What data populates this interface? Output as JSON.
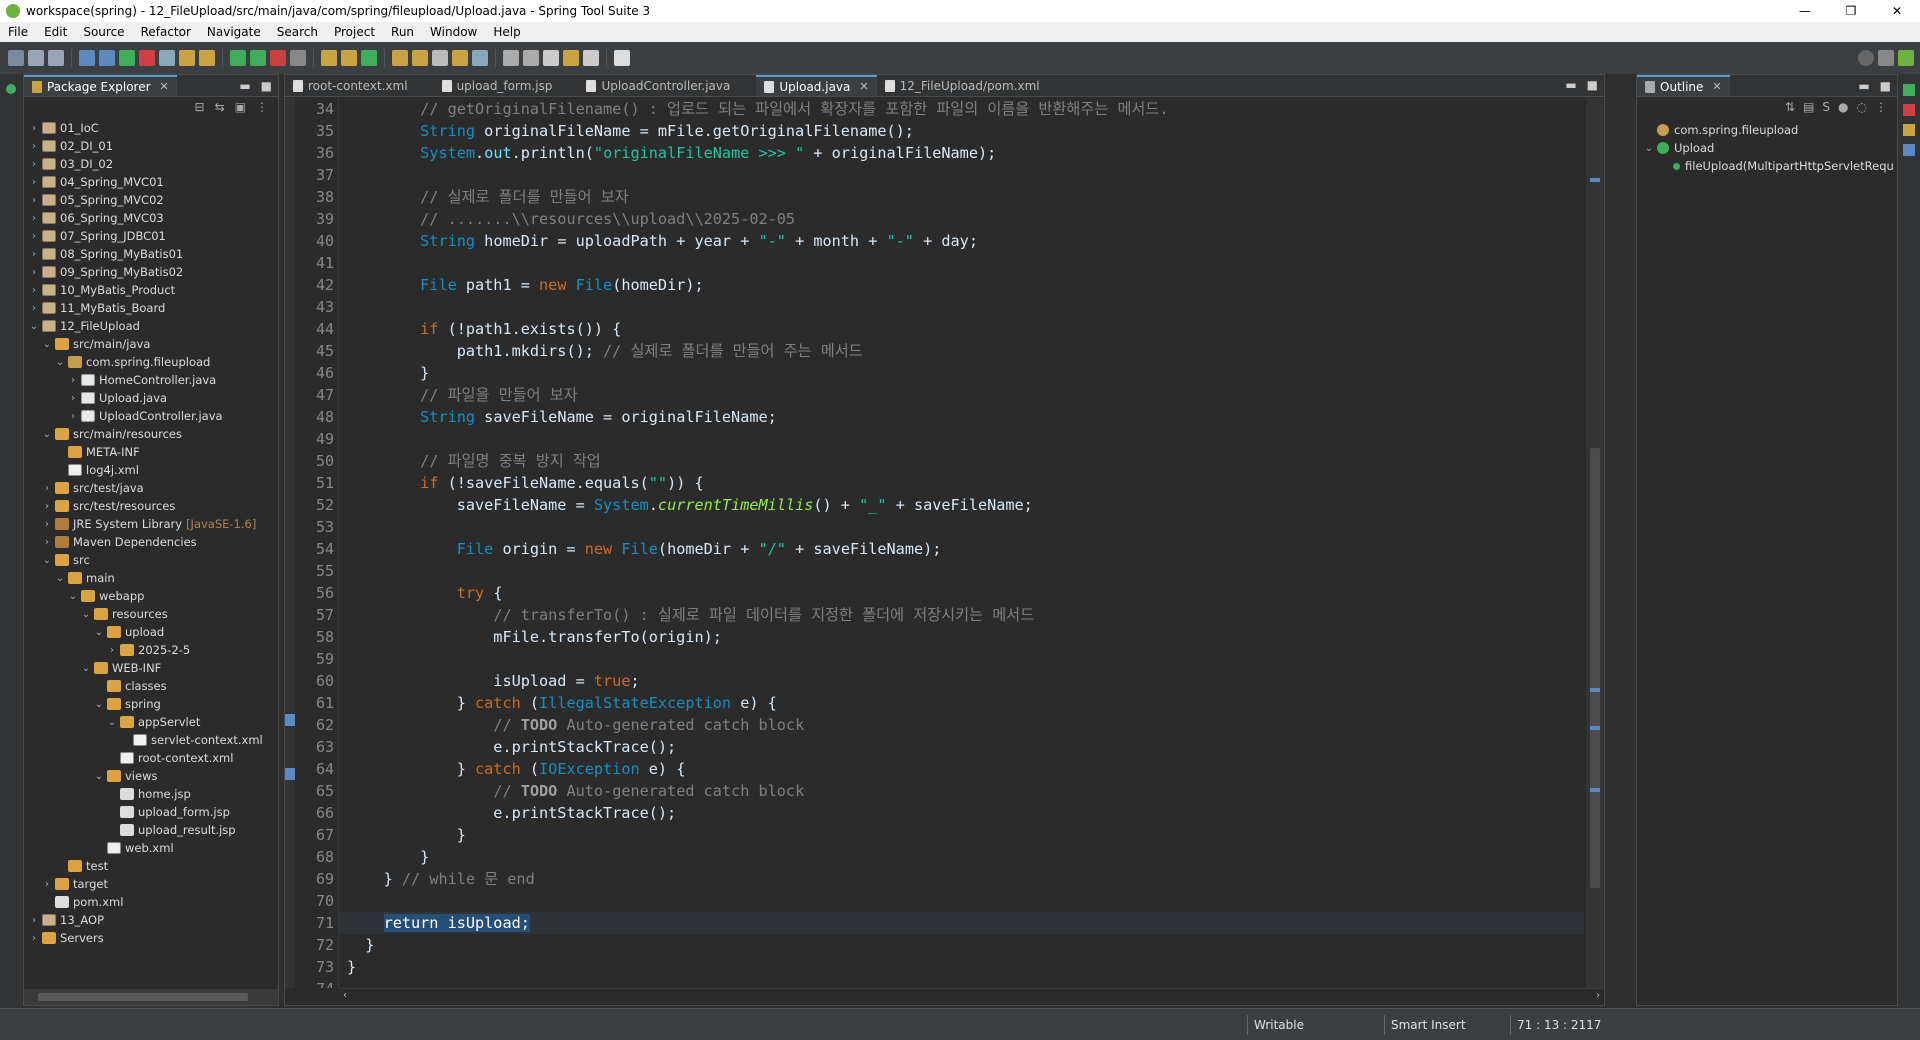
{
  "window": {
    "title": "workspace(spring) - 12_FileUpload/src/main/java/com/spring/fileupload/Upload.java - Spring Tool Suite 3",
    "controls": [
      "—",
      "❐",
      "✕"
    ]
  },
  "menu": [
    "File",
    "Edit",
    "Source",
    "Refactor",
    "Navigate",
    "Search",
    "Project",
    "Run",
    "Window",
    "Help"
  ],
  "package_explorer": {
    "title": "Package Explorer",
    "items": [
      {
        "label": "01_IoC",
        "indent": 0,
        "tw": "›",
        "icon": "proj"
      },
      {
        "label": "02_DI_01",
        "indent": 0,
        "tw": "›",
        "icon": "proj"
      },
      {
        "label": "03_DI_02",
        "indent": 0,
        "tw": "›",
        "icon": "proj"
      },
      {
        "label": "04_Spring_MVC01",
        "indent": 0,
        "tw": "›",
        "icon": "proj"
      },
      {
        "label": "05_Spring_MVC02",
        "indent": 0,
        "tw": "›",
        "icon": "proj"
      },
      {
        "label": "06_Spring_MVC03",
        "indent": 0,
        "tw": "›",
        "icon": "proj"
      },
      {
        "label": "07_Spring_JDBC01",
        "indent": 0,
        "tw": "›",
        "icon": "proj"
      },
      {
        "label": "08_Spring_MyBatis01",
        "indent": 0,
        "tw": "›",
        "icon": "proj"
      },
      {
        "label": "09_Spring_MyBatis02",
        "indent": 0,
        "tw": "›",
        "icon": "proj"
      },
      {
        "label": "10_MyBatis_Product",
        "indent": 0,
        "tw": "›",
        "icon": "proj"
      },
      {
        "label": "11_MyBatis_Board",
        "indent": 0,
        "tw": "›",
        "icon": "proj"
      },
      {
        "label": "12_FileUpload",
        "indent": 0,
        "tw": "⌄",
        "icon": "proj"
      },
      {
        "label": "src/main/java",
        "indent": 1,
        "tw": "⌄",
        "icon": "folder"
      },
      {
        "label": "com.spring.fileupload",
        "indent": 2,
        "tw": "⌄",
        "icon": "pkg"
      },
      {
        "label": "HomeController.java",
        "indent": 3,
        "tw": "›",
        "icon": "java"
      },
      {
        "label": "Upload.java",
        "indent": 3,
        "tw": "›",
        "icon": "java"
      },
      {
        "label": "UploadController.java",
        "indent": 3,
        "tw": "›",
        "icon": "java"
      },
      {
        "label": "src/main/resources",
        "indent": 1,
        "tw": "⌄",
        "icon": "folder"
      },
      {
        "label": "META-INF",
        "indent": 2,
        "tw": "",
        "icon": "folder"
      },
      {
        "label": "log4j.xml",
        "indent": 2,
        "tw": "",
        "icon": "xml"
      },
      {
        "label": "src/test/java",
        "indent": 1,
        "tw": "›",
        "icon": "folder"
      },
      {
        "label": "src/test/resources",
        "indent": 1,
        "tw": "›",
        "icon": "folder"
      },
      {
        "label": "JRE System Library",
        "suffix": "[JavaSE-1.6]",
        "indent": 1,
        "tw": "›",
        "icon": "jar"
      },
      {
        "label": "Maven Dependencies",
        "indent": 1,
        "tw": "›",
        "icon": "jar"
      },
      {
        "label": "src",
        "indent": 1,
        "tw": "⌄",
        "icon": "folder"
      },
      {
        "label": "main",
        "indent": 2,
        "tw": "⌄",
        "icon": "folder"
      },
      {
        "label": "webapp",
        "indent": 3,
        "tw": "⌄",
        "icon": "folder"
      },
      {
        "label": "resources",
        "indent": 4,
        "tw": "⌄",
        "icon": "folder"
      },
      {
        "label": "upload",
        "indent": 5,
        "tw": "⌄",
        "icon": "folder"
      },
      {
        "label": "2025-2-5",
        "indent": 6,
        "tw": "›",
        "icon": "folder"
      },
      {
        "label": "WEB-INF",
        "indent": 4,
        "tw": "⌄",
        "icon": "folder"
      },
      {
        "label": "classes",
        "indent": 5,
        "tw": "",
        "icon": "folder"
      },
      {
        "label": "spring",
        "indent": 5,
        "tw": "⌄",
        "icon": "folder"
      },
      {
        "label": "appServlet",
        "indent": 6,
        "tw": "⌄",
        "icon": "folder"
      },
      {
        "label": "servlet-context.xml",
        "indent": 7,
        "tw": "",
        "icon": "xml"
      },
      {
        "label": "root-context.xml",
        "indent": 6,
        "tw": "",
        "icon": "xml"
      },
      {
        "label": "views",
        "indent": 5,
        "tw": "⌄",
        "icon": "folder"
      },
      {
        "label": "home.jsp",
        "indent": 6,
        "tw": "",
        "icon": "file"
      },
      {
        "label": "upload_form.jsp",
        "indent": 6,
        "tw": "",
        "icon": "file"
      },
      {
        "label": "upload_result.jsp",
        "indent": 6,
        "tw": "",
        "icon": "file"
      },
      {
        "label": "web.xml",
        "indent": 5,
        "tw": "",
        "icon": "xml"
      },
      {
        "label": "test",
        "indent": 2,
        "tw": "",
        "icon": "folder"
      },
      {
        "label": "target",
        "indent": 1,
        "tw": "›",
        "icon": "folder"
      },
      {
        "label": "pom.xml",
        "indent": 1,
        "tw": "",
        "icon": "file"
      },
      {
        "label": "13_AOP",
        "indent": 0,
        "tw": "›",
        "icon": "proj"
      },
      {
        "label": "Servers",
        "indent": 0,
        "tw": "›",
        "icon": "folder"
      }
    ]
  },
  "editor": {
    "tabs": [
      {
        "label": "root-context.xml",
        "active": false
      },
      {
        "label": "upload_form.jsp",
        "active": false
      },
      {
        "label": "UploadController.java",
        "active": false
      },
      {
        "label": "Upload.java",
        "active": true
      },
      {
        "label": "12_FileUpload/pom.xml",
        "active": false
      }
    ],
    "lines": [
      {
        "n": "34",
        "segs": [
          [
            "        ",
            ""
          ],
          [
            "// getOriginalFilename() : 업로드 되는 파일에서 확장자를 포함한 파일의 이름을 반환해주는 메서드.",
            "cm"
          ]
        ]
      },
      {
        "n": "35",
        "segs": [
          [
            "        ",
            ""
          ],
          [
            "String",
            "ty"
          ],
          [
            " originalFileName = mFile.getOriginalFilename();",
            ""
          ]
        ]
      },
      {
        "n": "36",
        "segs": [
          [
            "        ",
            ""
          ],
          [
            "System",
            "ty"
          ],
          [
            ".",
            ""
          ],
          [
            "out",
            "fld"
          ],
          [
            ".println(",
            ""
          ],
          [
            "\"originalFileName >>> \"",
            "str"
          ],
          [
            " + originalFileName);",
            ""
          ]
        ]
      },
      {
        "n": "37",
        "segs": [
          [
            "",
            ""
          ]
        ]
      },
      {
        "n": "38",
        "segs": [
          [
            "        ",
            ""
          ],
          [
            "// 실제로 폴더를 만들어 보자",
            "cm"
          ]
        ]
      },
      {
        "n": "39",
        "segs": [
          [
            "        ",
            ""
          ],
          [
            "// .......\\\\resources\\\\upload\\\\2025-02-05",
            "cm"
          ]
        ]
      },
      {
        "n": "40",
        "segs": [
          [
            "        ",
            ""
          ],
          [
            "String",
            "ty"
          ],
          [
            " homeDir = uploadPath + year + ",
            ""
          ],
          [
            "\"-\"",
            "str"
          ],
          [
            " + month + ",
            ""
          ],
          [
            "\"-\"",
            "str"
          ],
          [
            " + day;",
            ""
          ]
        ]
      },
      {
        "n": "41",
        "segs": [
          [
            "",
            ""
          ]
        ]
      },
      {
        "n": "42",
        "segs": [
          [
            "        ",
            ""
          ],
          [
            "File",
            "ty"
          ],
          [
            " path1 = ",
            ""
          ],
          [
            "new",
            "kw"
          ],
          [
            " ",
            ""
          ],
          [
            "File",
            "ty"
          ],
          [
            "(homeDir);",
            ""
          ]
        ]
      },
      {
        "n": "43",
        "segs": [
          [
            "",
            ""
          ]
        ]
      },
      {
        "n": "44",
        "segs": [
          [
            "        ",
            ""
          ],
          [
            "if",
            "kw"
          ],
          [
            " (!path1.exists()) {",
            ""
          ]
        ]
      },
      {
        "n": "45",
        "segs": [
          [
            "            path1.mkdirs(); ",
            ""
          ],
          [
            "// 실제로 폴더를 만들어 주는 메서드",
            "cm"
          ]
        ]
      },
      {
        "n": "46",
        "segs": [
          [
            "        }",
            ""
          ]
        ]
      },
      {
        "n": "47",
        "segs": [
          [
            "        ",
            ""
          ],
          [
            "// 파일을 만들어 보자",
            "cm"
          ]
        ]
      },
      {
        "n": "48",
        "segs": [
          [
            "        ",
            ""
          ],
          [
            "String",
            "ty"
          ],
          [
            " saveFileName = originalFileName;",
            ""
          ]
        ]
      },
      {
        "n": "49",
        "segs": [
          [
            "",
            ""
          ]
        ]
      },
      {
        "n": "50",
        "segs": [
          [
            "        ",
            ""
          ],
          [
            "// 파일명 중복 방지 작업",
            "cm"
          ]
        ]
      },
      {
        "n": "51",
        "segs": [
          [
            "        ",
            ""
          ],
          [
            "if",
            "kw"
          ],
          [
            " (!saveFileName.equals(",
            ""
          ],
          [
            "\"\"",
            "str"
          ],
          [
            ")) {",
            ""
          ]
        ]
      },
      {
        "n": "52",
        "segs": [
          [
            "            saveFileName = ",
            ""
          ],
          [
            "System",
            "ty"
          ],
          [
            ".",
            ""
          ],
          [
            "currentTimeMillis",
            "it"
          ],
          [
            "() + ",
            ""
          ],
          [
            "\"_\"",
            "str"
          ],
          [
            " + saveFileName;",
            ""
          ]
        ]
      },
      {
        "n": "53",
        "segs": [
          [
            "",
            ""
          ]
        ]
      },
      {
        "n": "54",
        "segs": [
          [
            "            ",
            ""
          ],
          [
            "File",
            "ty"
          ],
          [
            " origin = ",
            ""
          ],
          [
            "new",
            "kw"
          ],
          [
            " ",
            ""
          ],
          [
            "File",
            "ty"
          ],
          [
            "(homeDir + ",
            ""
          ],
          [
            "\"/\"",
            "str"
          ],
          [
            " + saveFileName);",
            ""
          ]
        ]
      },
      {
        "n": "55",
        "segs": [
          [
            "",
            ""
          ]
        ]
      },
      {
        "n": "56",
        "segs": [
          [
            "            ",
            ""
          ],
          [
            "try",
            "kw"
          ],
          [
            " {",
            ""
          ]
        ]
      },
      {
        "n": "57",
        "segs": [
          [
            "                ",
            ""
          ],
          [
            "// transferTo() : 실제로 파일 데이터를 지정한 폴더에 저장시키는 메서드",
            "cm"
          ]
        ]
      },
      {
        "n": "58",
        "segs": [
          [
            "                mFile.transferTo(origin);",
            ""
          ]
        ]
      },
      {
        "n": "59",
        "segs": [
          [
            "",
            ""
          ]
        ]
      },
      {
        "n": "60",
        "segs": [
          [
            "                isUpload = ",
            ""
          ],
          [
            "true",
            "kw"
          ],
          [
            ";",
            ""
          ]
        ]
      },
      {
        "n": "61",
        "segs": [
          [
            "            } ",
            ""
          ],
          [
            "catch",
            "kw"
          ],
          [
            " (",
            ""
          ],
          [
            "IllegalStateException",
            "ty"
          ],
          [
            " e) {",
            ""
          ]
        ]
      },
      {
        "n": "62",
        "segs": [
          [
            "                ",
            ""
          ],
          [
            "// ",
            "cm"
          ],
          [
            "TODO",
            "todo"
          ],
          [
            " Auto-generated catch block",
            "cm"
          ]
        ]
      },
      {
        "n": "63",
        "segs": [
          [
            "                e.printStackTrace();",
            ""
          ]
        ]
      },
      {
        "n": "64",
        "segs": [
          [
            "            } ",
            ""
          ],
          [
            "catch",
            "kw"
          ],
          [
            " (",
            ""
          ],
          [
            "IOException",
            "ty"
          ],
          [
            " e) {",
            ""
          ]
        ]
      },
      {
        "n": "65",
        "segs": [
          [
            "                ",
            ""
          ],
          [
            "// ",
            "cm"
          ],
          [
            "TODO",
            "todo"
          ],
          [
            " Auto-generated catch block",
            "cm"
          ]
        ]
      },
      {
        "n": "66",
        "segs": [
          [
            "                e.printStackTrace();",
            ""
          ]
        ]
      },
      {
        "n": "67",
        "segs": [
          [
            "            }",
            ""
          ]
        ]
      },
      {
        "n": "68",
        "segs": [
          [
            "        }",
            ""
          ]
        ]
      },
      {
        "n": "69",
        "segs": [
          [
            "    } ",
            ""
          ],
          [
            "// while 문 end",
            "cm"
          ]
        ]
      },
      {
        "n": "70",
        "segs": [
          [
            "",
            ""
          ]
        ]
      },
      {
        "n": "71",
        "segs": [
          [
            "    ",
            ""
          ],
          [
            "return isUpload;",
            "sel"
          ]
        ],
        "current": true
      },
      {
        "n": "72",
        "segs": [
          [
            "  }",
            ""
          ]
        ]
      },
      {
        "n": "73",
        "segs": [
          [
            "}",
            ""
          ]
        ]
      },
      {
        "n": "74",
        "segs": [
          [
            "",
            ""
          ]
        ]
      }
    ]
  },
  "outline": {
    "title": "Outline",
    "items": [
      {
        "label": "com.spring.fileupload",
        "indent": 0,
        "tw": "",
        "color": "#c69c51"
      },
      {
        "label": "Upload",
        "indent": 0,
        "tw": "⌄",
        "color": "#3fae5a"
      },
      {
        "label": "fileUpload(MultipartHttpServletRequ",
        "indent": 1,
        "tw": "",
        "color": "#3fae5a"
      }
    ]
  },
  "status": {
    "writable": "Writable",
    "insert_mode": "Smart Insert",
    "position": "71 : 13 : 2117"
  },
  "colors": {
    "keyword": "#cc6c1d",
    "comment": "#808080",
    "string": "#17c6a3",
    "type": "#1290c3",
    "editor_bg": "#2b2b2b"
  }
}
